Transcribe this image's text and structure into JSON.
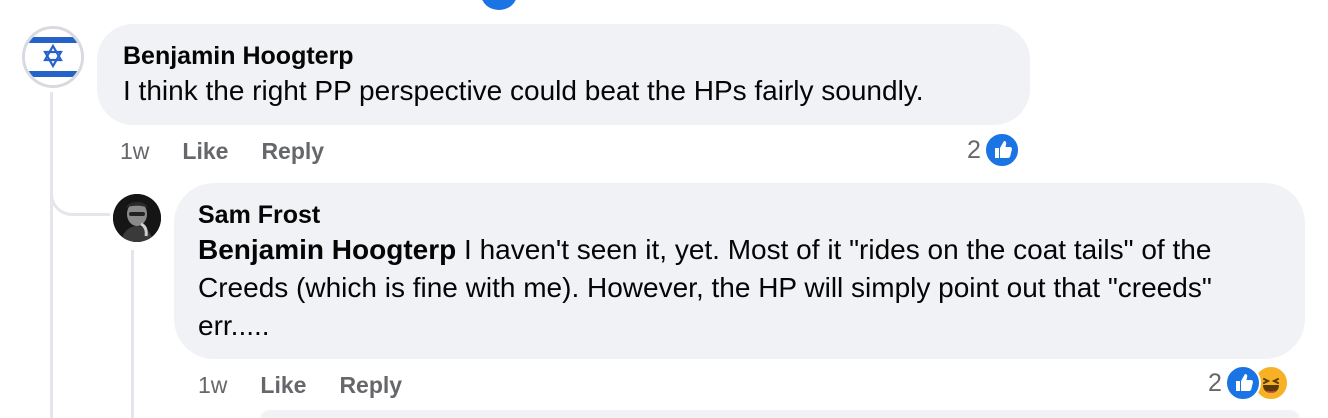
{
  "comments": [
    {
      "author": "Benjamin Hoogterp",
      "avatar": "israel-flag-avatar",
      "text": "I think the right PP perspective could beat the HPs fairly soundly.",
      "time": "1w",
      "like_label": "Like",
      "reply_label": "Reply",
      "reaction_count": "2",
      "reactions": [
        "like"
      ]
    },
    {
      "author": "Sam Frost",
      "avatar": "profile-photo-avatar",
      "mention": "Benjamin Hoogterp",
      "text": " I haven't seen it, yet. Most of it \"rides on the coat tails\" of the Creeds (which is fine with me). However, the HP will simply point out that \"creeds\" err.....",
      "time": "1w",
      "like_label": "Like",
      "reply_label": "Reply",
      "reaction_count": "2",
      "reactions": [
        "like",
        "haha"
      ]
    }
  ],
  "colors": {
    "bubble": "#f0f2f5",
    "meta_text": "#65676b",
    "like_blue": "#1b74e4",
    "haha_yellow": "#f7b125",
    "thread_line": "#e4e6eb"
  }
}
